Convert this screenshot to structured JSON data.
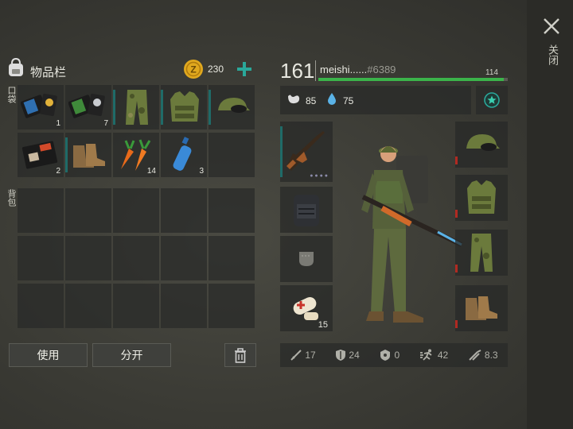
{
  "close_label": "关闭",
  "inventory": {
    "title": "物品栏",
    "coins": "230",
    "pocket_label": "口袋",
    "backpack_label": "背包",
    "pocket_counts": [
      "1",
      "7",
      "",
      "",
      "",
      "2",
      "",
      "14",
      "3",
      ""
    ]
  },
  "buttons": {
    "use": "使用",
    "split": "分开"
  },
  "player": {
    "level": "161",
    "name": "meishi......",
    "tag": "#6389",
    "xp_value": "114",
    "xp_fraction": 0.98,
    "food": "85",
    "water": "75"
  },
  "equipment": {
    "consumable_count": "15"
  },
  "stats": {
    "attack": "17",
    "defense": "24",
    "radiation": "0",
    "speed": "42",
    "weight": "8.3"
  },
  "colors": {
    "accent": "#2aa89a",
    "xp": "#3bb44a",
    "coin": "#e0a81e",
    "durability": "#b02a22"
  }
}
